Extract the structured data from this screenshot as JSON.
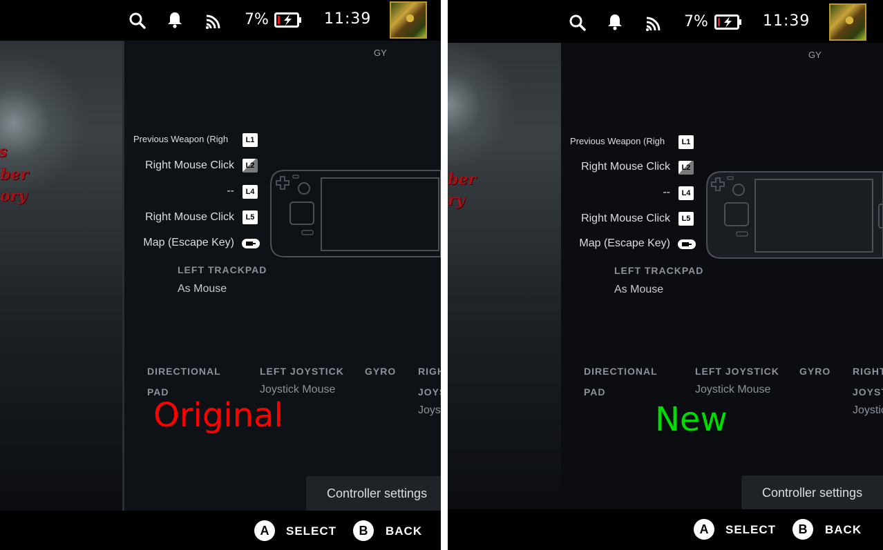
{
  "statusbar": {
    "battery_text": "7%",
    "time": "11:39"
  },
  "top_right_label": "GY",
  "mappings": [
    {
      "label": "Previous Weapon (Righ",
      "badge": "L1"
    },
    {
      "label": "Right Mouse Click",
      "badge": "L2"
    },
    {
      "label": "--",
      "badge": "L4"
    },
    {
      "label": "Right Mouse Click",
      "badge": "L5"
    },
    {
      "label": "Map (Escape Key)",
      "badge": ""
    }
  ],
  "left_trackpad": {
    "heading": "LEFT TRACKPAD",
    "value": "As Mouse"
  },
  "sections": {
    "dpad": {
      "heading_line1": "DIRECTIONAL",
      "heading_line2": "PAD"
    },
    "left_joystick": {
      "heading": "LEFT JOYSTICK",
      "value": "Joystick Mouse"
    },
    "gyro": {
      "heading": "GYRO"
    },
    "right_left": {
      "heading_line1": "RIGH",
      "heading_line2": "JOYS",
      "value": "Joys"
    },
    "right_right": {
      "heading_line1": "RIGHT",
      "heading_line2": "JOYST",
      "value": "Joystic"
    }
  },
  "art_words": {
    "left": [
      "s",
      "ber",
      "ory"
    ],
    "right": [
      "ber",
      "ry"
    ]
  },
  "controller_settings_label": "Controller settings",
  "bottom": {
    "a_glyph": "A",
    "select_label": "SELECT",
    "b_glyph": "B",
    "back_label": "BACK"
  },
  "watermarks": {
    "left": "Original",
    "right": "New",
    "left_color": "#ff0000",
    "right_color": "#00dd00"
  },
  "colors": {
    "background": "#0e1115",
    "statusbar": "#000000",
    "text": "#dcdedf",
    "heading": "#8b929a"
  }
}
